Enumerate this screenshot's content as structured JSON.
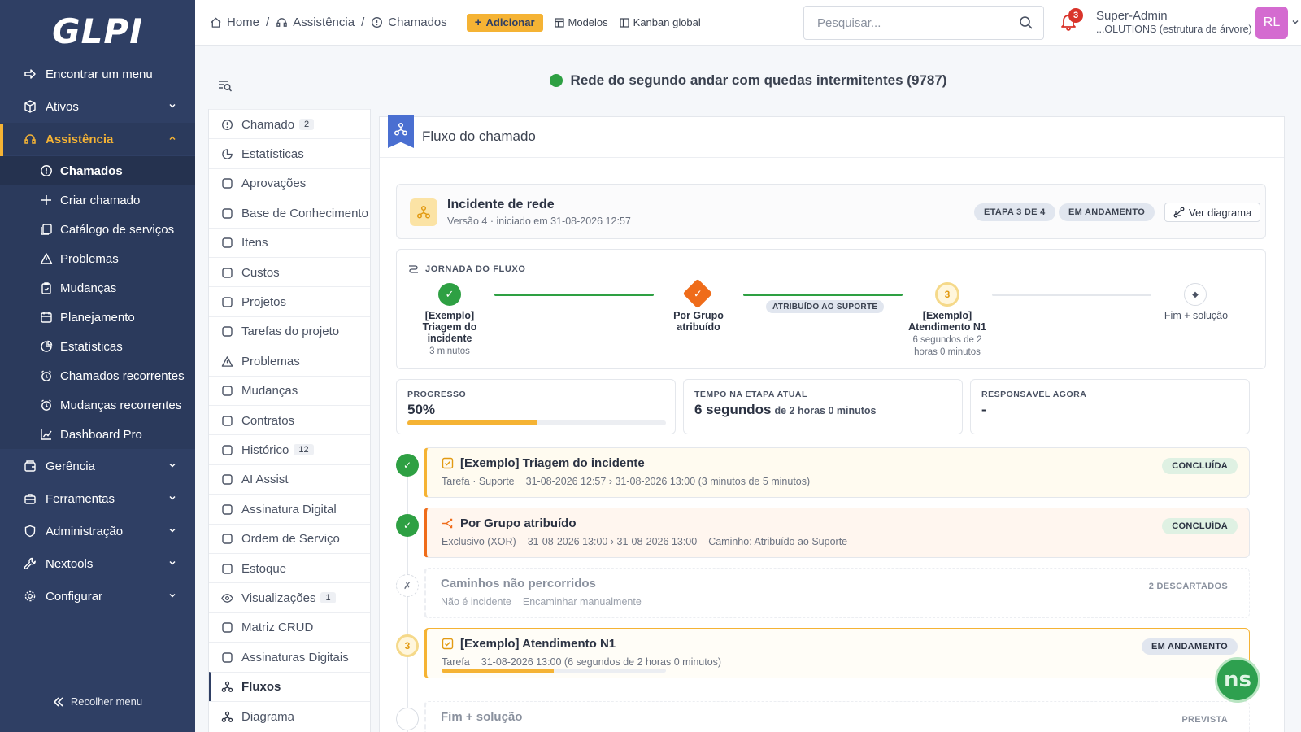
{
  "app": {
    "logo": "GLPI"
  },
  "sidebar": {
    "find_menu": "Encontrar um menu",
    "items": [
      {
        "label": "Ativos"
      },
      {
        "label": "Assistência"
      },
      {
        "label": "Gerência"
      },
      {
        "label": "Ferramentas"
      },
      {
        "label": "Administração"
      },
      {
        "label": "Nextools"
      },
      {
        "label": "Configurar"
      }
    ],
    "assist_sub": [
      {
        "label": "Chamados"
      },
      {
        "label": "Criar chamado"
      },
      {
        "label": "Catálogo de serviços"
      },
      {
        "label": "Problemas"
      },
      {
        "label": "Mudanças"
      },
      {
        "label": "Planejamento"
      },
      {
        "label": "Estatísticas"
      },
      {
        "label": "Chamados recorrentes"
      },
      {
        "label": "Mudanças recorrentes"
      },
      {
        "label": "Dashboard Pro"
      }
    ],
    "collapse_label": "Recolher menu"
  },
  "header": {
    "breadcrumb": [
      "Home",
      "Assistência",
      "Chamados"
    ],
    "add_label": "Adicionar",
    "models_label": "Modelos",
    "kanban_label": "Kanban global",
    "search_placeholder": "Pesquisar...",
    "notification_count": "3",
    "user_name": "Super-Admin",
    "user_entity": "...OLUTIONS (estrutura de árvore)",
    "avatar_initials": "RL"
  },
  "ticket": {
    "title": "Rede do segundo andar com quedas intermitentes (9787)",
    "status_color": "#2ea043"
  },
  "tabs": [
    {
      "label": "Chamado",
      "count": "2"
    },
    {
      "label": "Estatísticas",
      "count": ""
    },
    {
      "label": "Aprovações",
      "count": ""
    },
    {
      "label": "Base de Conhecimento",
      "count": ""
    },
    {
      "label": "Itens",
      "count": ""
    },
    {
      "label": "Custos",
      "count": ""
    },
    {
      "label": "Projetos",
      "count": ""
    },
    {
      "label": "Tarefas do projeto",
      "count": ""
    },
    {
      "label": "Problemas",
      "count": ""
    },
    {
      "label": "Mudanças",
      "count": ""
    },
    {
      "label": "Contratos",
      "count": ""
    },
    {
      "label": "Histórico",
      "count": "12"
    },
    {
      "label": "AI Assist",
      "count": ""
    },
    {
      "label": "Assinatura Digital",
      "count": ""
    },
    {
      "label": "Ordem de Serviço",
      "count": ""
    },
    {
      "label": "Estoque",
      "count": ""
    },
    {
      "label": "Visualizações",
      "count": "1"
    },
    {
      "label": "Matriz CRUD",
      "count": ""
    },
    {
      "label": "Assinaturas Digitais",
      "count": ""
    },
    {
      "label": "Fluxos",
      "count": ""
    },
    {
      "label": "Diagrama",
      "count": ""
    }
  ],
  "panel": {
    "title": "Fluxo do chamado",
    "flow_name": "Incidente de rede",
    "flow_meta": "Versão 4 · iniciado em 31-08-2026 12:57",
    "step_pill": "ETAPA 3 DE 4",
    "status_pill": "EM ANDAMENTO",
    "view_diagram": "Ver diagrama",
    "journey_title": "JORNADA DO FLUXO",
    "journey": [
      {
        "name": "[Exemplo] Triagem do incidente",
        "sub": "3 minutos",
        "mark": "✓"
      },
      {
        "name": "Por Grupo atribuído",
        "sub": "",
        "mark": "✓"
      },
      {
        "name": "[Exemplo] Atendimento N1",
        "sub": "6 segundos de 2 horas 0 minutos",
        "mark": "3"
      },
      {
        "name": "Fim + solução",
        "sub": "",
        "mark": "◆"
      }
    ],
    "path_label": "ATRIBUÍDO AO SUPORTE",
    "stats": {
      "progress_label": "PROGRESSO",
      "progress_value": "50%",
      "progress_fraction": 0.5,
      "time_label": "TEMPO NA ETAPA ATUAL",
      "time_value": "6 segundos",
      "time_of": "de 2 horas 0 minutos",
      "owner_label": "RESPONSÁVEL AGORA",
      "owner_value": "-"
    },
    "timeline": [
      {
        "title": "[Exemplo] Triagem do incidente",
        "meta": [
          "Tarefa · Suporte",
          "31-08-2026 12:57 › 31-08-2026 13:00 (3 minutos de 5 minutos)"
        ],
        "badge": "CONCLUÍDA",
        "mark": "✓"
      },
      {
        "title": "Por Grupo atribuído",
        "meta": [
          "Exclusivo (XOR)",
          "31-08-2026 13:00 › 31-08-2026 13:00",
          "Caminho: Atribuído ao Suporte"
        ],
        "badge": "CONCLUÍDA",
        "mark": "✓"
      },
      {
        "title": "Caminhos não percorridos",
        "meta": [
          "Não é incidente",
          "Encaminhar manualmente"
        ],
        "badge": "2 DESCARTADOS",
        "mark": "✗"
      },
      {
        "title": "[Exemplo] Atendimento N1",
        "meta": [
          "Tarefa",
          "31-08-2026 13:00 (6 segundos de 2 horas 0 minutos)"
        ],
        "badge": "EM ANDAMENTO",
        "mark": "3",
        "progress_fraction": 0.5
      },
      {
        "title": "Fim + solução",
        "meta": [],
        "badge": "PREVISTA",
        "mark": ""
      }
    ]
  },
  "fab_label": "ns",
  "colors": {
    "sidebar": "#2f3f64",
    "accent": "#f5b334",
    "success": "#2ea043",
    "xor_orange": "#ef6c1a"
  }
}
